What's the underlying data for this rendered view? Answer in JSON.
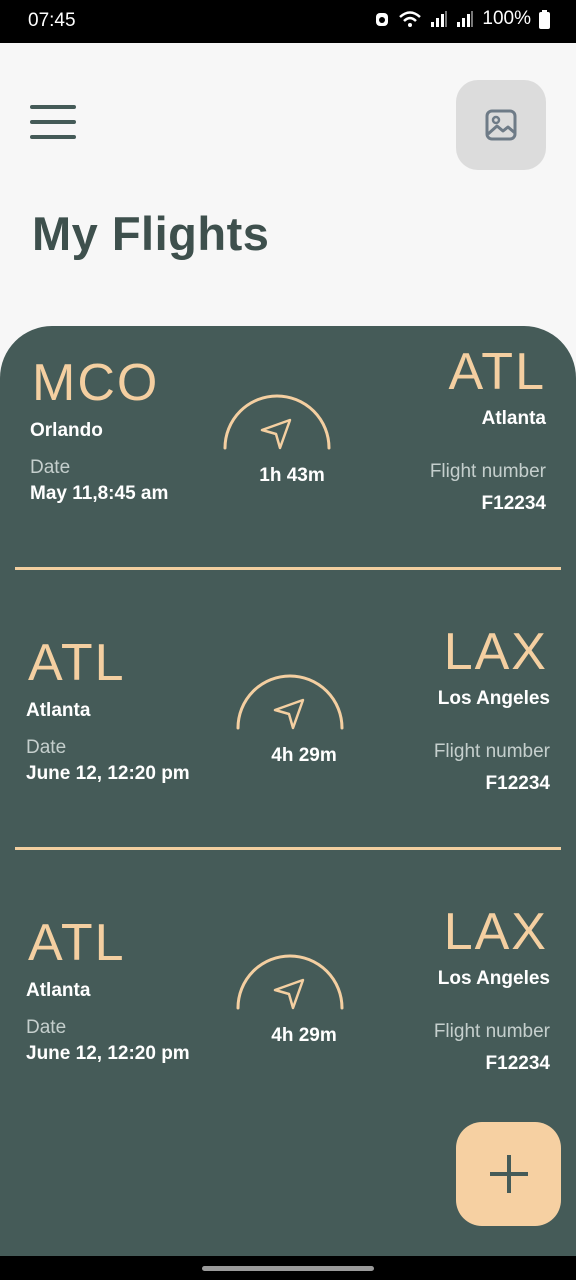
{
  "status_bar": {
    "time": "07:45",
    "battery": "100%"
  },
  "header": {
    "title": "My Flights"
  },
  "icons": {
    "menu": "hamburger-menu-icon",
    "image": "image-icon",
    "plane": "navigation-arrow-icon",
    "add": "plus-icon"
  },
  "colors": {
    "panel": "#455b58",
    "accent": "#f4cfa1",
    "title": "#3e504d",
    "fab": "#f6d0a2"
  },
  "flights": [
    {
      "from_code": "MCO",
      "from_city": "Orlando",
      "date_label": "Date",
      "date": "May 11,8:45 am",
      "duration": "1h 43m",
      "to_code": "ATL",
      "to_city": "Atlanta",
      "flight_number_label": "Flight number",
      "flight_number": "F12234"
    },
    {
      "from_code": "ATL",
      "from_city": "Atlanta",
      "date_label": "Date",
      "date": "June 12, 12:20 pm",
      "duration": "4h 29m",
      "to_code": "LAX",
      "to_city": "Los Angeles",
      "flight_number_label": "Flight number",
      "flight_number": "F12234"
    },
    {
      "from_code": "ATL",
      "from_city": "Atlanta",
      "date_label": "Date",
      "date": "June 12, 12:20 pm",
      "duration": "4h 29m",
      "to_code": "LAX",
      "to_city": "Los Angeles",
      "flight_number_label": "Flight number",
      "flight_number": "F12234"
    }
  ]
}
